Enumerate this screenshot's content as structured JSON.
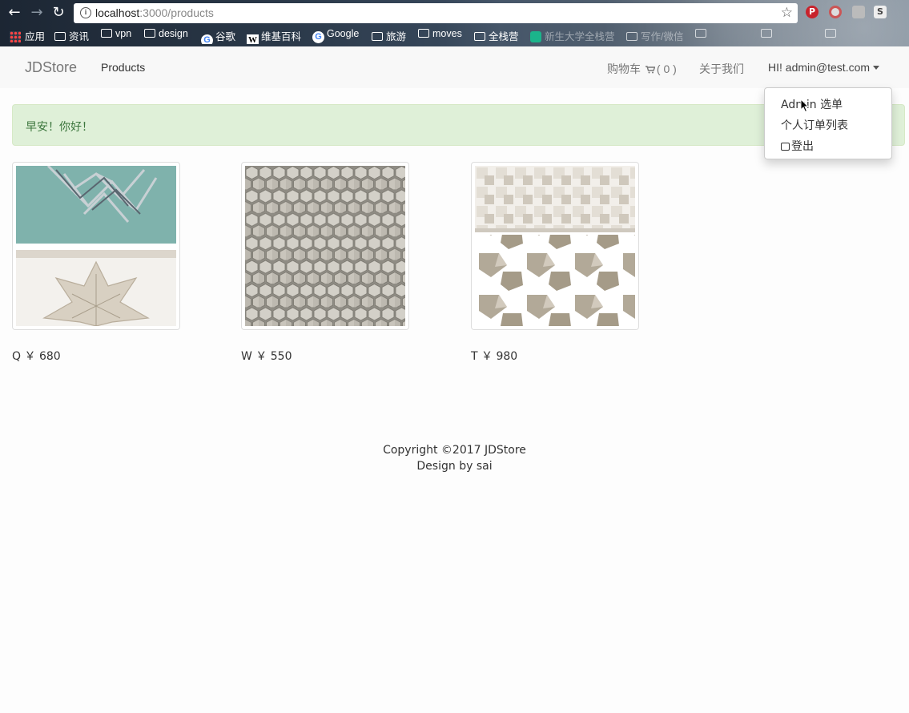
{
  "browser": {
    "url_host": "localhost",
    "url_path": ":3000/products",
    "bookmarks": [
      {
        "label": "应用",
        "icon": "apps-icon"
      },
      {
        "label": "资讯",
        "icon": "folder-icon"
      },
      {
        "label": "vpn",
        "icon": "folder-icon"
      },
      {
        "label": "design",
        "icon": "folder-icon"
      },
      {
        "label": "谷歌",
        "icon": "google-icon"
      },
      {
        "label": "维基百科",
        "icon": "wikipedia-icon"
      },
      {
        "label": "Google",
        "icon": "google-icon"
      },
      {
        "label": "旅游",
        "icon": "folder-icon"
      },
      {
        "label": "moves",
        "icon": "folder-icon"
      },
      {
        "label": "全栈营",
        "icon": "folder-icon"
      },
      {
        "label": "新生大学全栈营",
        "icon": "newuniv-icon"
      },
      {
        "label": "写作/微信",
        "icon": "folder-icon"
      }
    ]
  },
  "navbar": {
    "brand": "JDStore",
    "products": "Products",
    "cart": "购物车",
    "cart_count": "( 0 )",
    "about": "关于我们",
    "user": "HI! admin@test.com"
  },
  "alert": {
    "text": "早安！你好！"
  },
  "dropdown": {
    "items": [
      "Admin 选单",
      "个人订单列表",
      "登出"
    ]
  },
  "products": [
    {
      "name": "Q",
      "currency": "￥",
      "price": "680"
    },
    {
      "name": "W",
      "currency": "￥",
      "price": "550"
    },
    {
      "name": "T",
      "currency": "￥",
      "price": "980"
    }
  ],
  "footer": {
    "copyright": "Copyright ©2017 JDStore",
    "design": "Design by sai"
  }
}
